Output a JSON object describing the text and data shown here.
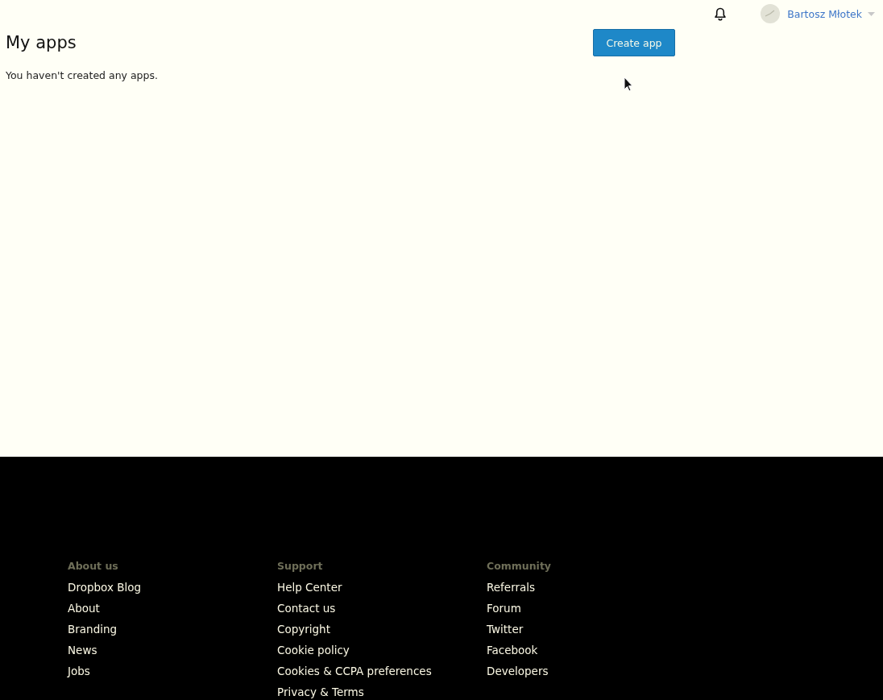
{
  "header": {
    "user_name": "Bartosz Młotek"
  },
  "page": {
    "title": "My apps",
    "create_button": "Create app",
    "empty_message": "You haven't created any apps."
  },
  "footer": {
    "columns": [
      {
        "heading": "About us",
        "links": [
          "Dropbox Blog",
          "About",
          "Branding",
          "News",
          "Jobs"
        ]
      },
      {
        "heading": "Support",
        "links": [
          "Help Center",
          "Contact us",
          "Copyright",
          "Cookie policy",
          "Cookies & CCPA preferences",
          "Privacy & Terms"
        ]
      },
      {
        "heading": "Community",
        "links": [
          "Referrals",
          "Forum",
          "Twitter",
          "Facebook",
          "Developers"
        ]
      }
    ]
  }
}
